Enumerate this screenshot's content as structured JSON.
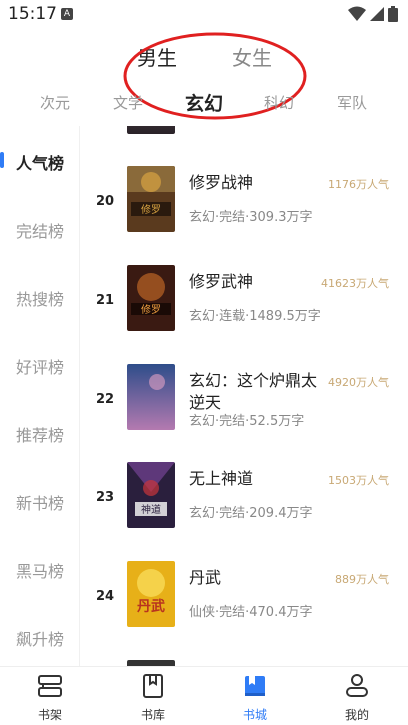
{
  "status_bar": {
    "time": "15:17",
    "notification_icon": "A"
  },
  "gender_tabs": [
    {
      "label": "男生",
      "active": true
    },
    {
      "label": "女生",
      "active": false
    }
  ],
  "category_tabs": [
    {
      "label": "次元",
      "active": false
    },
    {
      "label": "文学",
      "active": false
    },
    {
      "label": "玄幻",
      "active": true
    },
    {
      "label": "科幻",
      "active": false
    },
    {
      "label": "军队",
      "active": false
    }
  ],
  "sidebar": {
    "items": [
      {
        "label": "人气榜",
        "active": true
      },
      {
        "label": "完结榜",
        "active": false
      },
      {
        "label": "热搜榜",
        "active": false
      },
      {
        "label": "好评榜",
        "active": false
      },
      {
        "label": "推荐榜",
        "active": false
      },
      {
        "label": "新书榜",
        "active": false
      },
      {
        "label": "黑马榜",
        "active": false
      },
      {
        "label": "飙升榜",
        "active": false
      }
    ]
  },
  "books": [
    {
      "rank": "20",
      "title": "修罗战神",
      "popularity": "1176万人气",
      "meta": "玄幻·完结·309.3万字",
      "cover_color": "#5a3a1e",
      "cover_accent": "#d9a441"
    },
    {
      "rank": "21",
      "title": "修罗武神",
      "popularity": "41623万人气",
      "meta": "玄幻·连载·1489.5万字",
      "cover_color": "#3a1a12",
      "cover_accent": "#e07a2a"
    },
    {
      "rank": "22",
      "title": "玄幻：这个炉鼎太逆天",
      "popularity": "4920万人气",
      "meta": "玄幻·完结·52.5万字",
      "cover_color": "#2e4d8a",
      "cover_accent": "#e3a1c4"
    },
    {
      "rank": "23",
      "title": "无上神道",
      "popularity": "1503万人气",
      "meta": "玄幻·完结·209.4万字",
      "cover_color": "#2a1f3d",
      "cover_accent": "#c9343a"
    },
    {
      "rank": "24",
      "title": "丹武",
      "popularity": "889万人气",
      "meta": "仙侠·完结·470.4万字",
      "cover_color": "#e7b018",
      "cover_accent": "#b8331f"
    }
  ],
  "bottom_nav": [
    {
      "label": "书架",
      "icon": "bookshelf-icon",
      "active": false
    },
    {
      "label": "书库",
      "icon": "library-icon",
      "active": false
    },
    {
      "label": "书城",
      "icon": "bookstore-icon",
      "active": true
    },
    {
      "label": "我的",
      "icon": "profile-icon",
      "active": false
    }
  ],
  "colors": {
    "accent": "#2f7cf6",
    "popularity": "#c8a874",
    "annotation": "#e02020"
  }
}
